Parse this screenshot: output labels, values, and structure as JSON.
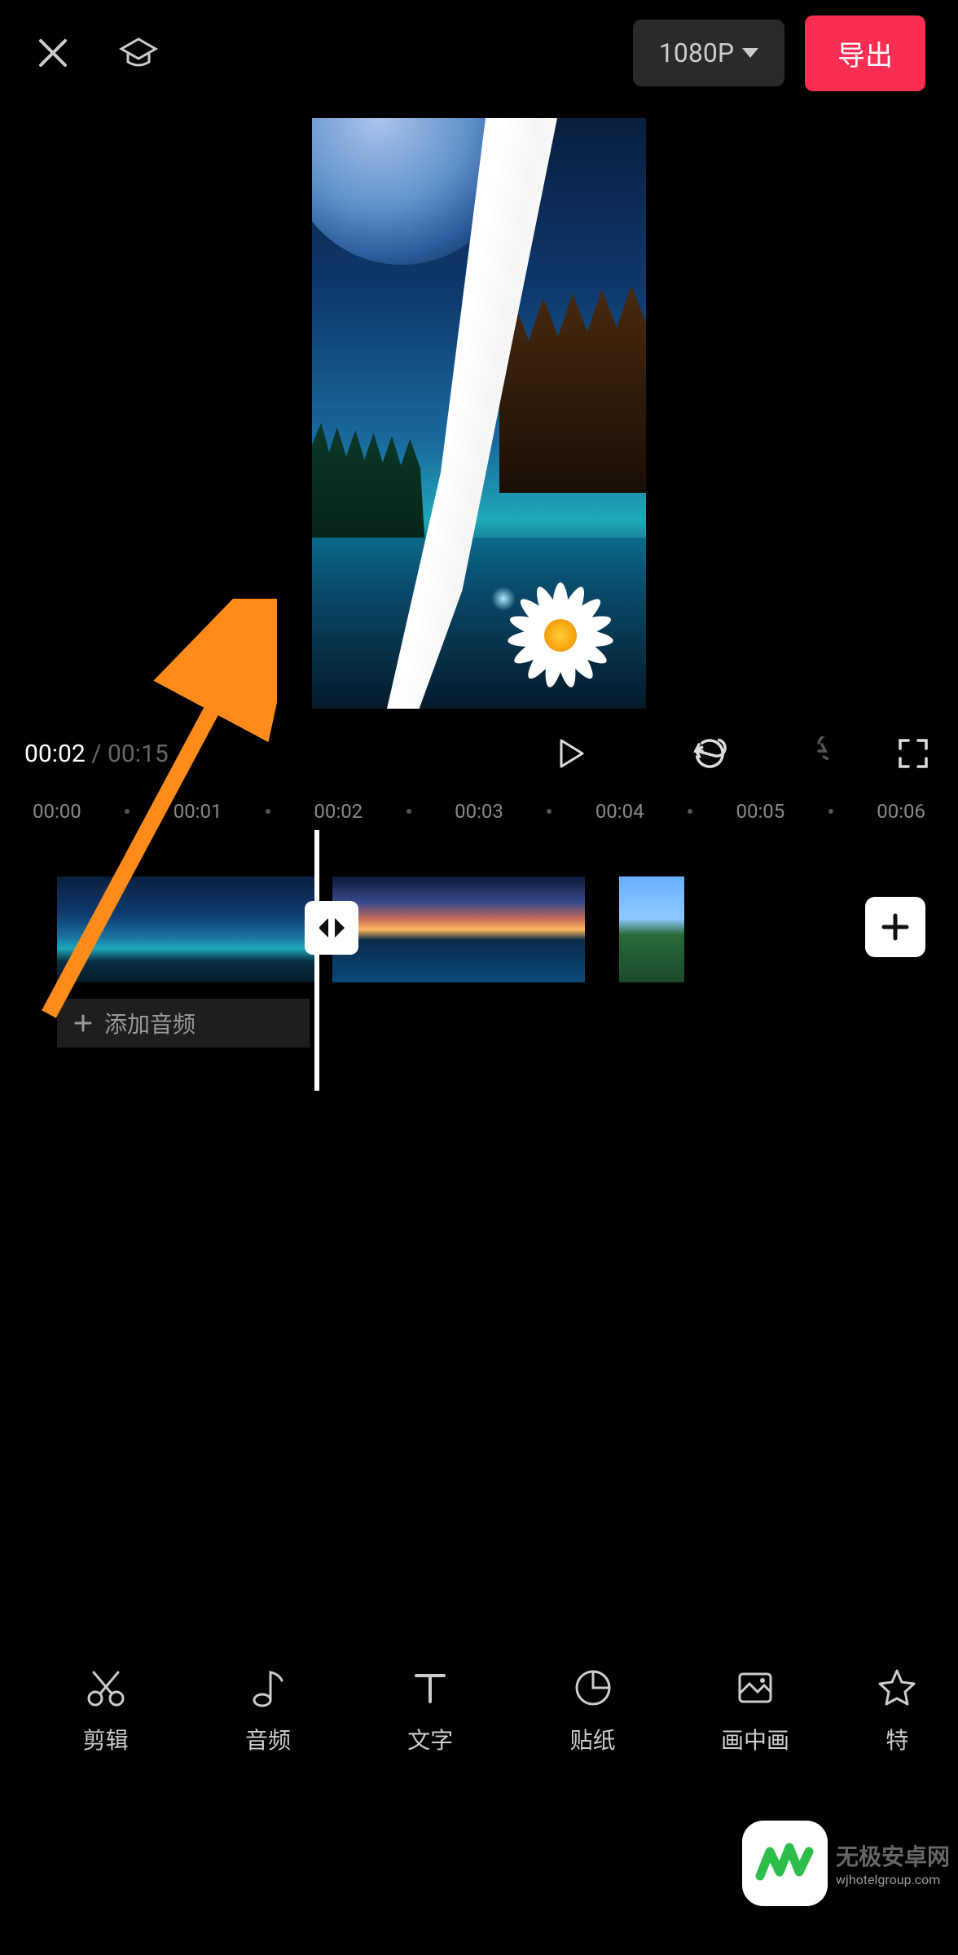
{
  "topbar": {
    "resolution": "1080P",
    "export_label": "导出"
  },
  "playback": {
    "current_time": "00:02",
    "total_time": "00:15",
    "separator": " / "
  },
  "ruler": {
    "ticks": [
      "00:00",
      "00:01",
      "00:02",
      "00:03",
      "00:04",
      "00:05",
      "00:06"
    ]
  },
  "timeline": {
    "add_audio_label": "添加音频"
  },
  "bottom_nav": {
    "items": [
      {
        "icon": "scissors",
        "label": "剪辑"
      },
      {
        "icon": "note",
        "label": "音频"
      },
      {
        "icon": "text",
        "label": "文字"
      },
      {
        "icon": "sticker",
        "label": "贴纸"
      },
      {
        "icon": "pip",
        "label": "画中画"
      },
      {
        "icon": "star",
        "label": "特"
      }
    ]
  },
  "watermark": {
    "main": "无极安卓网",
    "sub": "wjhotelgroup.com"
  },
  "colors": {
    "accent": "#fa2d52",
    "arrow": "#ff8c1a",
    "wm_green": "#2dbd4a"
  }
}
